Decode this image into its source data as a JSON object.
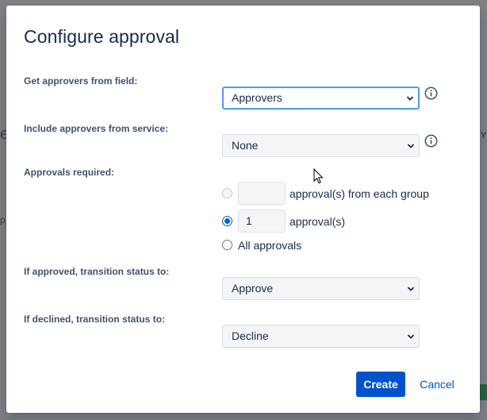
{
  "dialog": {
    "title": "Configure approval"
  },
  "fields": {
    "approvers_field": {
      "label": "Get approvers from field:",
      "value": "Approvers",
      "info_icon": "info-icon"
    },
    "approvers_service": {
      "label": "Include approvers from service:",
      "value": "None",
      "info_icon": "info-icon"
    },
    "approvals_required": {
      "label": "Approvals required:",
      "options": [
        {
          "text": "approval(s) from each group",
          "input_value": "",
          "selected": false,
          "disabled": true
        },
        {
          "text": "approval(s)",
          "input_value": "1",
          "selected": true,
          "disabled": false
        },
        {
          "text": "All approvals",
          "selected": false,
          "disabled": false
        }
      ]
    },
    "approved_transition": {
      "label": "If approved, transition status to:",
      "value": "Approve"
    },
    "declined_transition": {
      "label": "If declined, transition status to:",
      "value": "Decline"
    }
  },
  "actions": {
    "create_label": "Create",
    "cancel_label": "Cancel"
  },
  "colors": {
    "primary": "#0052cc",
    "focus_ring": "#4c9aff",
    "text": "#172b4d",
    "label": "#42526e",
    "overlay": "#7f8184"
  }
}
